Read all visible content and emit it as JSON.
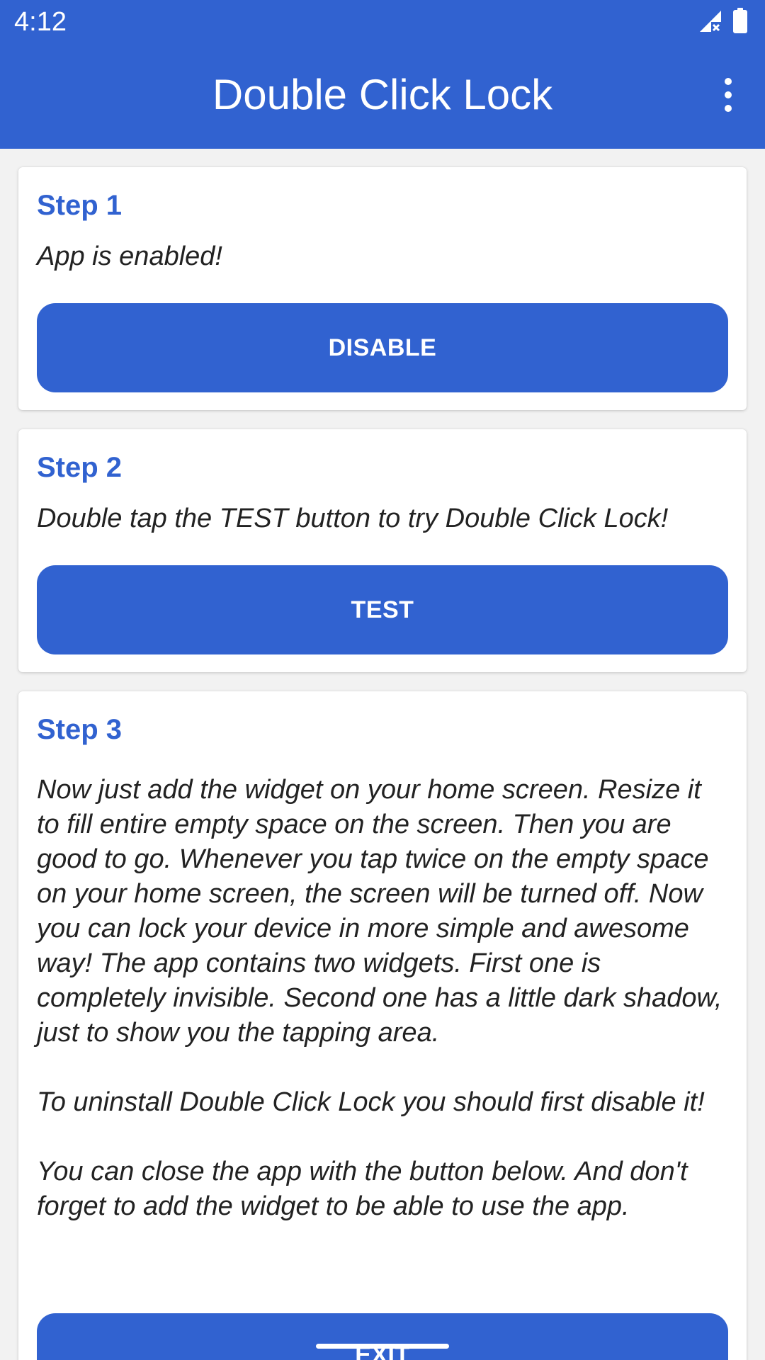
{
  "status_bar": {
    "time": "4:12",
    "icons": [
      "signal-no-data-icon",
      "battery-icon"
    ]
  },
  "app_bar": {
    "title": "Double Click Lock",
    "overflow_icon": "more-vert-icon"
  },
  "cards": [
    {
      "step": "Step 1",
      "text": "App is enabled!",
      "button": "DISABLE"
    },
    {
      "step": "Step 2",
      "text": "Double tap the TEST button to try Double Click Lock!",
      "button": "TEST"
    },
    {
      "step": "Step 3",
      "paragraphs": [
        "Now just add the widget on your home screen. Resize it to fill entire empty space on the screen. Then you are good to go. Whenever you tap twice on the empty space on your home screen, the screen will be turned off. Now you can lock your device in more simple and awesome way! The app contains two widgets. First one is completely invisible. Second one has a little dark shadow, just to show you the tapping area.",
        "To uninstall Double Click Lock you should first disable it!",
        "You can close the app with the button below. And don't forget to add the widget to be able to use the app."
      ],
      "button": "EXIT"
    }
  ],
  "colors": {
    "primary": "#3162d0",
    "background": "#f2f2f2",
    "card": "#ffffff",
    "text": "#222222"
  }
}
